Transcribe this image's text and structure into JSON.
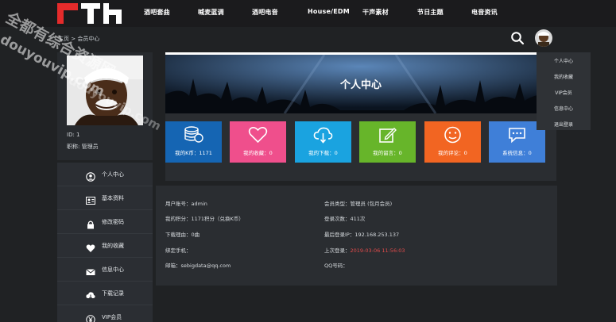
{
  "nav": {
    "items": [
      "酒吧套曲",
      "喊麦蓝调",
      "酒吧电音",
      "House/EDM",
      "干声素材",
      "节日主题",
      "电音资讯"
    ]
  },
  "breadcrumb": "主页 > 会员中心",
  "profile": {
    "id_text": "ID: 1",
    "role_text": "职称: 管理员"
  },
  "sidebar": {
    "items": [
      {
        "label": "个人中心",
        "icon": "user-circle-icon"
      },
      {
        "label": "基本资料",
        "icon": "id-card-icon"
      },
      {
        "label": "修改密码",
        "icon": "lock-icon"
      },
      {
        "label": "我的收藏",
        "icon": "heart-icon"
      },
      {
        "label": "信息中心",
        "icon": "envelope-icon"
      },
      {
        "label": "下载记录",
        "icon": "cloud-download-icon"
      },
      {
        "label": "VIP会员",
        "icon": "yen-icon"
      }
    ]
  },
  "banner": {
    "title": "个人中心"
  },
  "stats": [
    {
      "label": "我的K币：1171",
      "color": "#1565b3",
      "icon": "coins-icon"
    },
    {
      "label": "我的收藏：0",
      "color": "#ef4f8c",
      "icon": "heart-outline-icon"
    },
    {
      "label": "我的下载：0",
      "color": "#1aa3e0",
      "icon": "cloud-download-icon"
    },
    {
      "label": "我的留言：0",
      "color": "#67b52a",
      "icon": "edit-icon"
    },
    {
      "label": "我的评论：0",
      "color": "#f26522",
      "icon": "smile-icon"
    },
    {
      "label": "系统信息：0",
      "color": "#3f7fd8",
      "icon": "chat-icon"
    }
  ],
  "info": {
    "account": "用户账号：admin",
    "member_type": "会员类型：管理员 (包月会员)",
    "points": "我的积分：1171积分（兑换K币）",
    "login_count": "登录次数：411次",
    "download_reason": "下载理由：0曲",
    "last_ip": "最后登录IP：192.168.253.137",
    "phone": "绑定手机：",
    "last_login_label": "上次登录：",
    "last_login_value": "2019-03-06 11:56:03",
    "email": "邮箱：sebigdata@qq.com",
    "qq": "QQ号码："
  },
  "dropdown": {
    "items": [
      "个人中心",
      "我的收藏",
      "VIP会员",
      "信息中心",
      "退出登录"
    ]
  },
  "watermark": {
    "line1": "全都有综合资源网",
    "line2": "douyouvip.com",
    "line3": "douyouvip.com"
  },
  "colors": {
    "accent_red": "#e24b4b",
    "background": "#202224"
  }
}
